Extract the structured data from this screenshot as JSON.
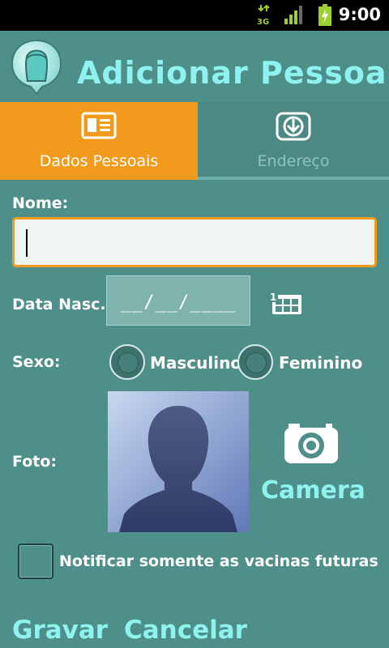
{
  "status_bar": {
    "network": "3G",
    "time": "9:00"
  },
  "header": {
    "title": "Adicionar Pessoa",
    "icon": "person-head-icon"
  },
  "tabs": [
    {
      "label": "Dados Pessoais",
      "icon": "id-card-icon",
      "active": true
    },
    {
      "label": "Endereço",
      "icon": "download-icon",
      "active": false
    }
  ],
  "form": {
    "name_label": "Nome:",
    "name_value": "",
    "birth_label": "Data Nasc.:",
    "birth_value": "__/__/____",
    "sex_label": "Sexo:",
    "sex_options": [
      "Masculino",
      "Feminino"
    ],
    "photo_label": "Foto:",
    "camera_label": "Camera",
    "notify_label": "Notificar somente as vacinas futuras",
    "notify_checked": false
  },
  "actions": {
    "save": "Gravar",
    "cancel": "Cancelar"
  },
  "colors": {
    "background": "#4f8f8a",
    "accent": "#f29a1b",
    "title": "#8ef2ef"
  }
}
